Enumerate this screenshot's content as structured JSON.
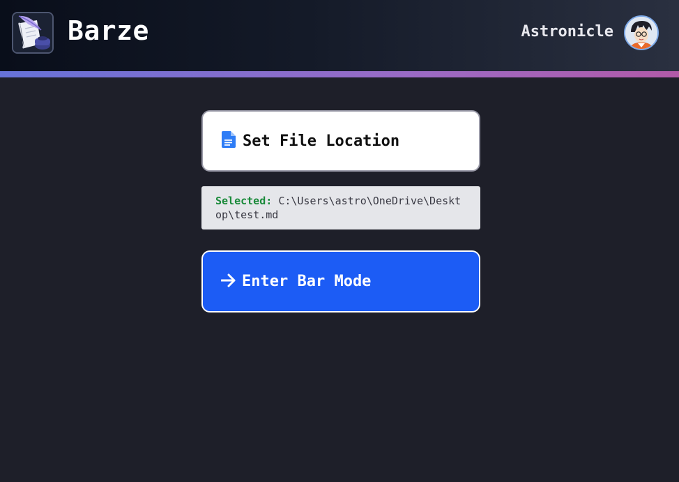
{
  "header": {
    "app_title": "Barze",
    "logo_icon": "quill-ink-icon",
    "username": "Astronicle",
    "avatar_icon": "user-avatar"
  },
  "colors": {
    "background": "#1e1f29",
    "accent_gradient_start": "#6672d8",
    "accent_gradient_end": "#b25aa8",
    "primary_button": "#1c5cf5",
    "selected_label": "#1a8a3a"
  },
  "main": {
    "file_button": {
      "icon": "document-icon",
      "label": "Set File Location"
    },
    "selection": {
      "label": "Selected:",
      "path": "C:\\Users\\astro\\OneDrive\\Desktop\\test.md"
    },
    "enter_button": {
      "icon": "arrow-right-icon",
      "label": "Enter Bar Mode"
    }
  }
}
